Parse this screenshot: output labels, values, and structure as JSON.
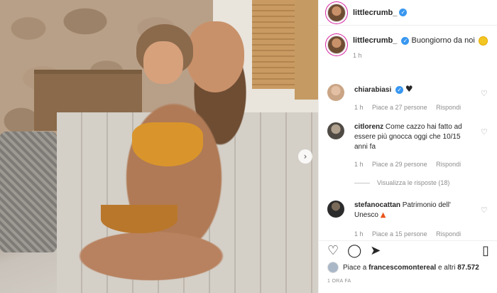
{
  "post": {
    "username": "littlecrumb_",
    "verified_mark": "✓",
    "next_arrow": "›"
  },
  "caption": {
    "username": "littlecrumb_",
    "text": "Buongiorno da noi",
    "time": "1 h"
  },
  "comments": [
    {
      "username": "chiarabiasi",
      "verified": true,
      "text": "",
      "emoji": "black-heart",
      "time": "1 h",
      "likes": "Piace a 27 persone",
      "reply": "Rispondi"
    },
    {
      "username": "citlorenz",
      "verified": false,
      "text": "Come cazzo hai fatto ad essere più gnocca oggi che 10/15 anni fa",
      "time": "1 h",
      "likes": "Piace a 29 persone",
      "reply": "Rispondi",
      "view_replies": "Visualizza le risposte (18)"
    },
    {
      "username": "stefanocattan",
      "verified": false,
      "text": "Patrimonio dell' Unesco",
      "emoji": "fire",
      "time": "1 h",
      "likes": "Piace a 15 persone",
      "reply": "Rispondi"
    }
  ],
  "likes_line": {
    "prefix": "Piace a",
    "user": "francescomontereal",
    "suffix": "e altri",
    "count": "87.572"
  },
  "posted": "1 ORA FA",
  "colors": {
    "verified": "#3897f0",
    "muted": "#8e8e8e",
    "text": "#262626",
    "bikini": "#d9952c"
  },
  "icons": [
    "heart-icon",
    "comment-icon",
    "share-icon",
    "bookmark-icon",
    "next-arrow-icon"
  ]
}
